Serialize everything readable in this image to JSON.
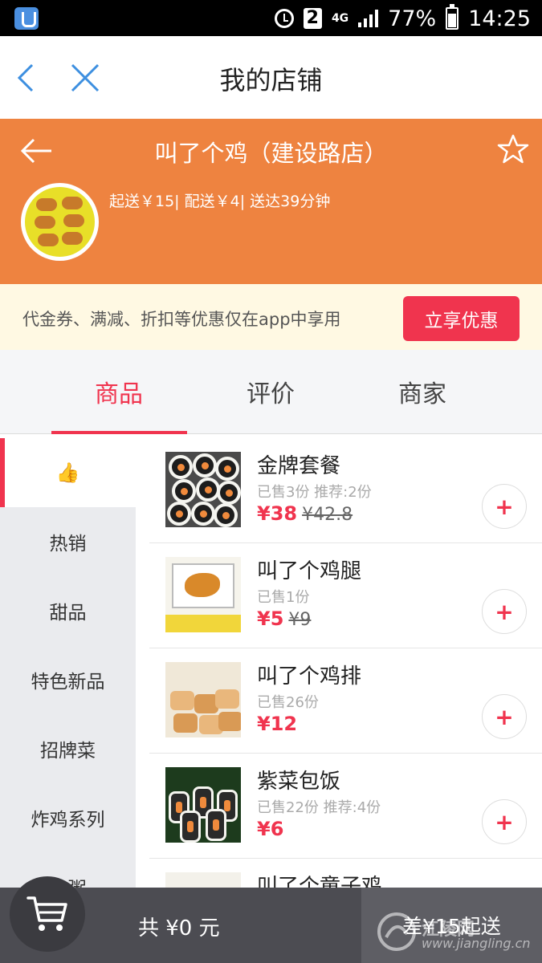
{
  "status_bar": {
    "sim": "2",
    "network": "4G",
    "battery": "77%",
    "time": "14:25"
  },
  "nav": {
    "title": "我的店铺"
  },
  "store": {
    "name": "叫了个鸡（建设路店）",
    "info": "起送￥15| 配送￥4| 送达39分钟"
  },
  "promo": {
    "text": "代金券、满减、折扣等优惠仅在app中享用",
    "button": "立享优惠"
  },
  "tabs": [
    {
      "label": "商品",
      "active": true
    },
    {
      "label": "评价",
      "active": false
    },
    {
      "label": "商家",
      "active": false
    }
  ],
  "categories": [
    {
      "label": "👍",
      "active": true
    },
    {
      "label": "热销",
      "active": false
    },
    {
      "label": "甜品",
      "active": false
    },
    {
      "label": "特色新品",
      "active": false
    },
    {
      "label": "招牌菜",
      "active": false
    },
    {
      "label": "炸鸡系列",
      "active": false
    },
    {
      "label": "小粥",
      "active": false
    }
  ],
  "products": [
    {
      "name": "金牌套餐",
      "sold": "已售3份  推荐:2份",
      "price": "¥38",
      "old_price": "¥42.8",
      "add": "+"
    },
    {
      "name": "叫了个鸡腿",
      "sold": "已售1份",
      "price": "¥5",
      "old_price": "¥9",
      "add": "+"
    },
    {
      "name": "叫了个鸡排",
      "sold": "已售26份",
      "price": "¥12",
      "old_price": "",
      "add": "+"
    },
    {
      "name": "紫菜包饭",
      "sold": "已售22份  推荐:4份",
      "price": "¥6",
      "old_price": "",
      "add": "+"
    },
    {
      "name": "叫了个童子鸡",
      "sold": "",
      "price": "",
      "old_price": "",
      "add": ""
    }
  ],
  "cart": {
    "total": "共 ¥0 元",
    "minimum": "差¥15起送"
  },
  "watermark": {
    "text": "江陵网",
    "url": "www.jiangling.cn"
  },
  "colors": {
    "accent": "#f0344e",
    "store_banner": "#ee8340",
    "promo_bg": "#fff9e3",
    "cart_bar": "#4c4c52"
  }
}
